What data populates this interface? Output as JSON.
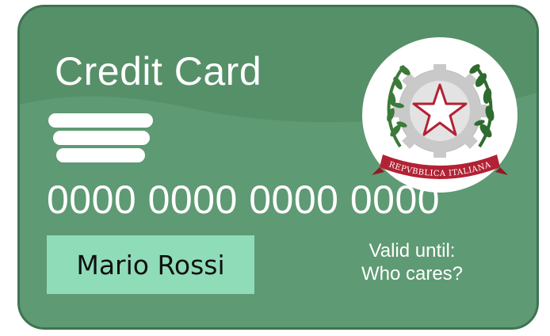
{
  "card": {
    "title": "Credit Card",
    "number": "0000 0000 0000 0000",
    "holder_name": "Mario Rossi",
    "valid_label": "Valid until:",
    "valid_value": "Who cares?",
    "emblem_text": "REPVBBLICA ITALIANA"
  },
  "icons": {
    "emblem": "italian-republic-emblem-icon",
    "chip": "magnetic-stripes-icon"
  },
  "colors": {
    "card_green": "#5e9a73",
    "card_border": "#3f7352",
    "name_box": "#8fdcb9",
    "text": "#ffffff",
    "emblem_red": "#b22234",
    "emblem_green": "#3c7a3a"
  }
}
